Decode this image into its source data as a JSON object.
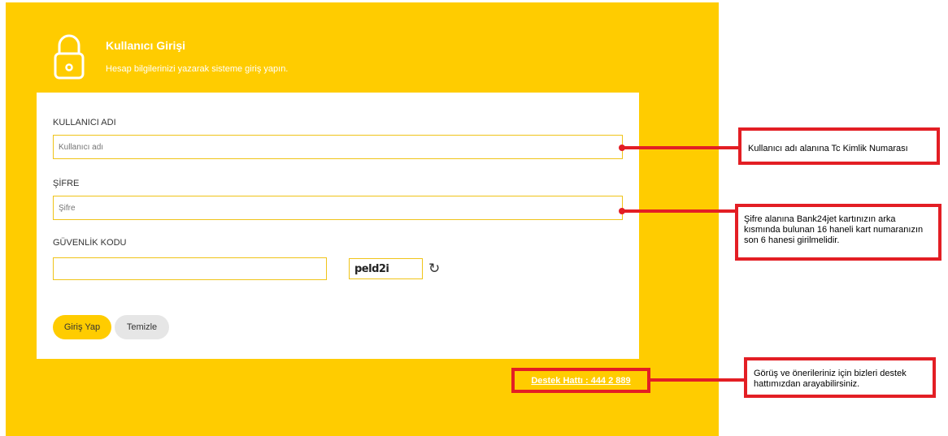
{
  "header": {
    "title": "Kullanıcı Girişi",
    "subtitle": "Hesap bilgilerinizi yazarak sisteme giriş yapın."
  },
  "form": {
    "username_label": "KULLANICI ADI",
    "username_placeholder": "Kullanıcı adı",
    "password_label": "ŞİFRE",
    "password_placeholder": "Şifre",
    "security_label": "GÜVENLİK KODU",
    "security_value": "",
    "captcha_text": "peld2i",
    "login_button": "Giriş Yap",
    "clear_button": "Temizle"
  },
  "support": {
    "link_text": "Destek Hattı : 444 2 889"
  },
  "callouts": {
    "username_note": "Kullanıcı adı alanına Tc Kimlik Numarası",
    "password_note": "Şifre alanına Bank24jet kartınızın arka kısmında bulunan 16 haneli kart numaranızın son 6 hanesi girilmelidir.",
    "support_note": "Görüş ve önerileriniz için bizleri destek hattımızdan arayabilirsiniz."
  },
  "colors": {
    "brand_yellow": "#ffcc00",
    "annotation_red": "#e31e24"
  },
  "icons": {
    "lock": "lock-icon",
    "refresh": "refresh-icon"
  }
}
